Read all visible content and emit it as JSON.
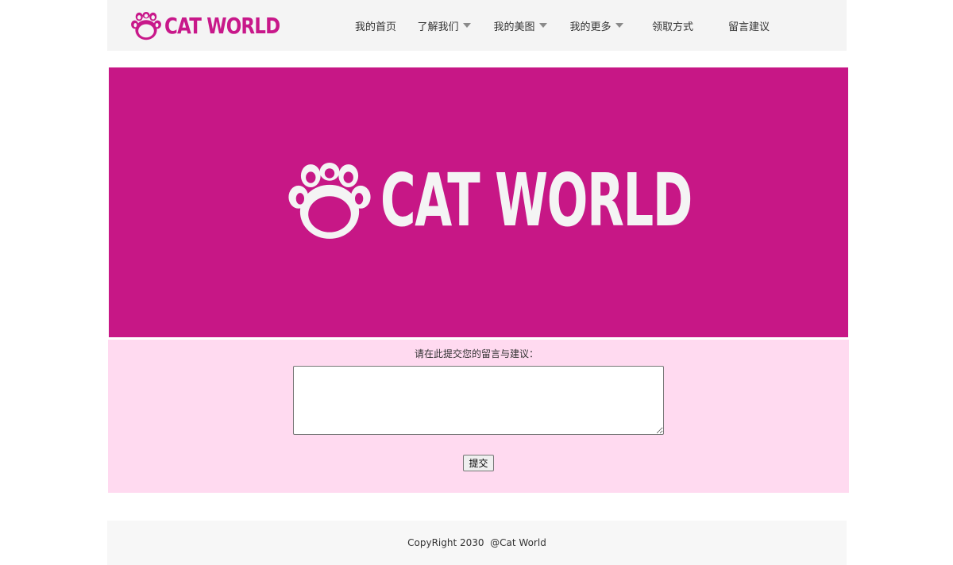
{
  "brand": {
    "name": "CAT WORLD",
    "accent_color": "#c8188a",
    "banner_color": "#c71786",
    "form_bg_color": "#ffdaf0"
  },
  "nav": {
    "items": [
      {
        "label": "我的首页",
        "has_dropdown": false
      },
      {
        "label": "了解我们",
        "has_dropdown": true
      },
      {
        "label": "我的美图",
        "has_dropdown": true
      },
      {
        "label": "我的更多",
        "has_dropdown": true
      },
      {
        "label": "领取方式",
        "has_dropdown": false
      },
      {
        "label": "留言建议",
        "has_dropdown": false
      }
    ]
  },
  "banner": {
    "logo_text": "CAT WORLD",
    "icon": "paw-icon"
  },
  "form": {
    "label": "请在此提交您的留言与建议：",
    "textarea_value": "",
    "submit_label": "提交"
  },
  "footer": {
    "copyright": "CopyRight 2030  @Cat World"
  }
}
